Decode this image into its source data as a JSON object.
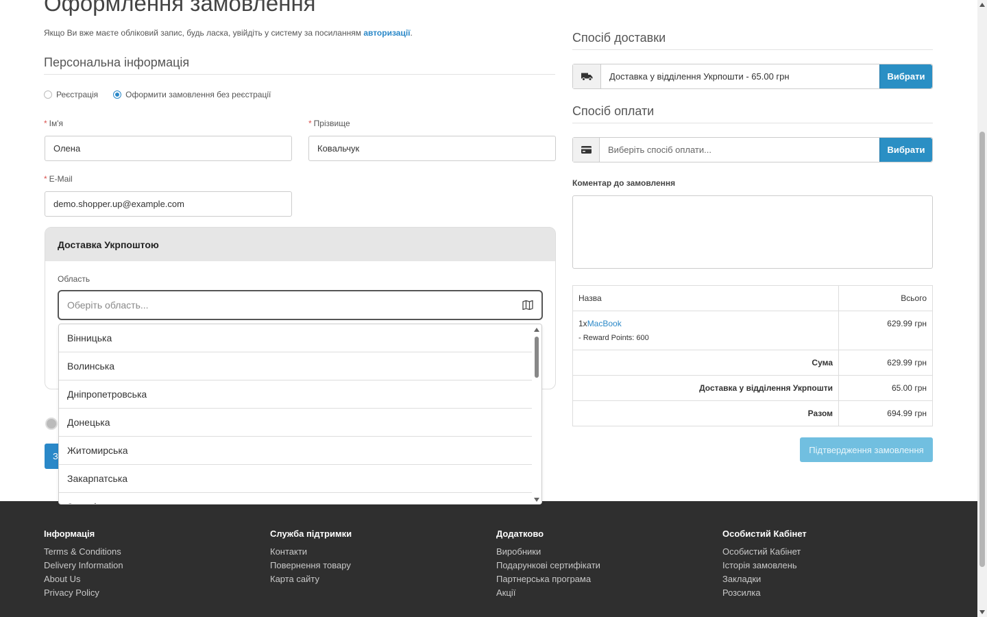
{
  "page": {
    "title": "Оформлення замовлення",
    "login_note": "Якщо Ви вже маєте обліковий запис, будь ласка, увійдіть у систему за посиланням ",
    "login_link": "авторизації",
    "login_suffix": "."
  },
  "personal": {
    "title": "Персональна інформація",
    "radio_register": "Реєстрація",
    "radio_guest": "Оформити замовлення без реєстрації",
    "selected": "guest",
    "firstname_label": "Ім'я",
    "firstname_value": "Олена",
    "lastname_label": "Прізвище",
    "lastname_value": "Ковальчук",
    "email_label": "E-Mail",
    "email_value": "demo.shopper.up@example.com",
    "required_mark": "*"
  },
  "delivery_panel": {
    "title": "Доставка Укрпоштою",
    "region_label": "Область",
    "region_placeholder": "Оберіть область...",
    "options": [
      "Вінницька",
      "Волинська",
      "Дніпропетровська",
      "Донецька",
      "Житомирська",
      "Закарпатська",
      "Запорізька"
    ],
    "hidden_button_label": "З"
  },
  "shipping": {
    "title": "Спосіб доставки",
    "value": "Доставка у відділення Укрпошти - 65.00 грн",
    "button": "Вибрати",
    "icon": "truck-icon"
  },
  "payment": {
    "title": "Спосіб оплати",
    "placeholder": "Виберіть спосіб оплати...",
    "button": "Вибрати",
    "icon": "credit-card-icon"
  },
  "comment": {
    "label": "Коментар до замовлення",
    "value": ""
  },
  "order_table": {
    "header_name": "Назва",
    "header_total": "Всього",
    "product_qty": "1x",
    "product_name": "MacBook",
    "product_reward": "- Reward Points: 600",
    "product_total": "629.99 грн",
    "subtotal_label": "Сума",
    "subtotal_value": "629.99 грн",
    "shipping_label": "Доставка у відділення Укрпошти",
    "shipping_value": "65.00 грн",
    "total_label": "Разом",
    "total_value": "694.99 грн"
  },
  "confirm_button": "Підтвердження замовлення",
  "footer": {
    "columns": [
      {
        "title": "Інформація",
        "links": [
          "Terms & Conditions",
          "Delivery Information",
          "About Us",
          "Privacy Policy"
        ]
      },
      {
        "title": "Служба підтримки",
        "links": [
          "Контакти",
          "Повернення товару",
          "Карта сайту"
        ]
      },
      {
        "title": "Додатково",
        "links": [
          "Виробники",
          "Подарункові сертифікати",
          "Партнерська програма",
          "Акції"
        ]
      },
      {
        "title": "Особистий Кабінет",
        "links": [
          "Особистий Кабінет",
          "Історія замовлень",
          "Закладки",
          "Розсилка"
        ]
      }
    ]
  },
  "colors": {
    "accent": "#2a88c8",
    "button": "#2a8fc4",
    "confirm_disabled": "#71bfe0",
    "footer_bg": "#2f2f2f",
    "required": "#d9534f"
  }
}
